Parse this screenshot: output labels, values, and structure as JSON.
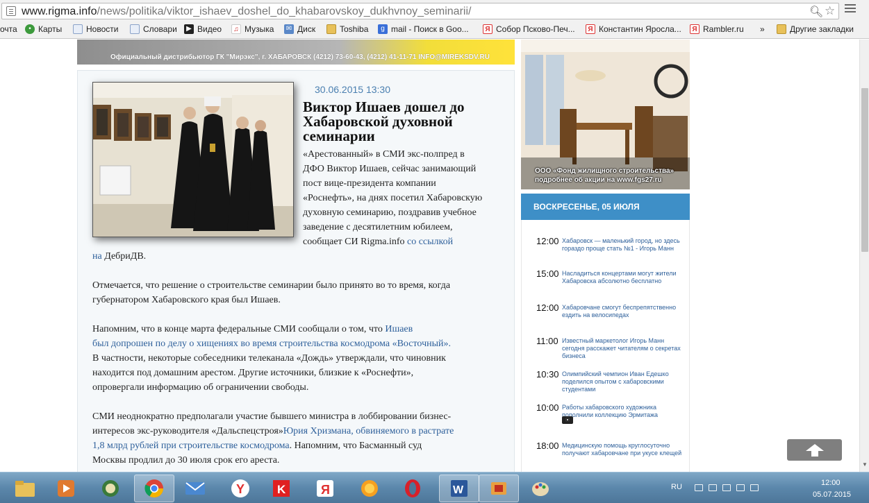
{
  "browser": {
    "url_host": "www.rigma.info",
    "url_path": "/news/politika/viktor_ishaev_doshel_do_khabarovskoy_dukhvnoy_seminarii/"
  },
  "bookmarks": [
    {
      "label": "очта",
      "icon": "mail-icon"
    },
    {
      "label": "Карты",
      "icon": "maps-icon"
    },
    {
      "label": "Новости",
      "icon": "page-icon"
    },
    {
      "label": "Словари",
      "icon": "page-icon"
    },
    {
      "label": "Видео",
      "icon": "video-icon"
    },
    {
      "label": "Музыка",
      "icon": "music-icon"
    },
    {
      "label": "Диск",
      "icon": "disk-icon"
    },
    {
      "label": "Toshiba",
      "icon": "folder-icon"
    },
    {
      "label": "mail - Поиск в Goo...",
      "icon": "google-icon"
    },
    {
      "label": "Собор Псково-Печ...",
      "icon": "yandex-icon"
    },
    {
      "label": "Константин Яросла...",
      "icon": "yandex-icon"
    },
    {
      "label": "Rambler.ru",
      "icon": "yandex-icon"
    },
    {
      "label": "»",
      "icon": ""
    },
    {
      "label": "Другие закладки",
      "icon": "folder-icon"
    }
  ],
  "top_banner": {
    "text": "Официальный дистрибьютор ГК \"Мирэкс\", г. ХАБАРОВСК (4212) 73-60-43, (4212) 41-11-71 INFO@MIREKSDV.RU"
  },
  "article": {
    "date": "30.06.2015 13:30",
    "title": "Виктор Ишаев дошел до Хабаровской духовной семинарии",
    "lead_lines": [
      "«Арестованный» в СМИ экс-полпред в",
      "ДФО Виктор Ишаев, сейчас занимающий",
      "пост вице-президента компании",
      "«Роснефть», на днях посетил Хабаровскую",
      "духовную семинарию, поздравив учебное",
      "заведение с десятилетним юбилеем,"
    ],
    "lead_last_text": "сообщает СИ Rigma.info ",
    "lead_link_1": "со ссылкой",
    "lead_link_2": "на ",
    "lead_source": "ДебриДВ.",
    "p2_line1": "Отмечается, что решение о строительстве семинарии было принято во то время, когда",
    "p2_line2": "губернатором Хабаровского края был Ишаев.",
    "p3_line1_text": "Напомним, что в конце марта федеральные СМИ сообщали о том, что ",
    "p3_line1_link": "Ишаев",
    "p3_line2_link": "был допрошен по делу о хищениях во время строительства космодрома «Восточный».",
    "p3_line3": "В частности, некоторые собеседники телеканала «Дождь» утверждали, что чиновник",
    "p3_line4": "находится под домашним арестом. Другие источники, близкие к «Роснефти»,",
    "p3_line5": "опровергали информацию об ограничении свободы.",
    "p4_line1": "СМИ неоднократно предполагали участие бывшего министра в лоббировании бизнес-",
    "p4_line2_text": "интересов экс-руководителя «Дальспецстроя»",
    "p4_line2_link": "Юрия Хризмана, обвиняемого в растрате",
    "p4_line3_link": "1,8 млрд рублей при строительстве космодрома",
    "p4_line3_text": ". Напомним, что Басманный суд",
    "p4_line4": "Москвы продлил до 30 июля срок его ареста."
  },
  "right_ad": {
    "line1": "ООО «Фонд жилищного строительства»",
    "line2": "подробнее об акции на www.fgs27.ru"
  },
  "news_feed": {
    "header": "ВОСКРЕСЕНЬЕ, 05 ИЮЛЯ",
    "items": [
      {
        "time": "12:00",
        "title": "Хабаровск — маленький город, но здесь гораздо проще стать №1 - Игорь Манн"
      },
      {
        "time": "15:00",
        "title": "Насладиться концертами могут жители Хабаровска абсолютно бесплатно"
      },
      {
        "time": "12:00",
        "title": "Хабаровчане смогут беспрепятственно ездить на велосипедах"
      },
      {
        "time": "11:00",
        "title": "Известный маркетолог Игорь Манн сегодня расскажет читателям о секретах бизнеса"
      },
      {
        "time": "10:30",
        "title": "Олимпийский чемпион Иван Едешко поделился опытом с хабаровскими студентами"
      },
      {
        "time": "10:00",
        "title": "Работы хабаровского художника пополнили коллекцию Эрмитажа"
      },
      {
        "time": "18:00",
        "title": "Медицинскую помощь круглосуточно получают хабаровчане при укусе клещей"
      }
    ]
  },
  "taskbar": {
    "lang": "RU",
    "time": "12:00",
    "date": "05.07.2015"
  }
}
